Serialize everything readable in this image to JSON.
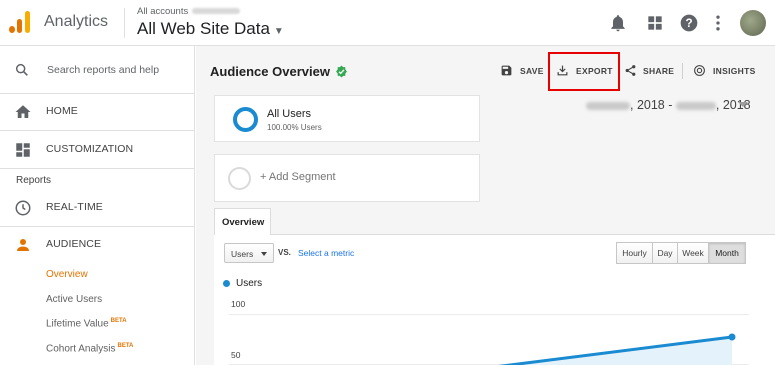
{
  "header": {
    "app_title": "Analytics",
    "account_label": "All accounts",
    "property_name": "All Web Site Data",
    "avatar_label": "user avatar"
  },
  "sidebar": {
    "search_placeholder": "Search reports and help",
    "nav": [
      {
        "label": "HOME",
        "icon": "home-icon"
      },
      {
        "label": "CUSTOMIZATION",
        "icon": "dashboard-icon"
      }
    ],
    "reports_label": "Reports",
    "report_nav": [
      {
        "label": "REAL-TIME",
        "icon": "clock-icon"
      },
      {
        "label": "AUDIENCE",
        "icon": "person-icon"
      }
    ],
    "audience_sub": [
      {
        "label": "Overview",
        "active": true
      },
      {
        "label": "Active Users"
      },
      {
        "label": "Lifetime Value",
        "badge": "BETA"
      },
      {
        "label": "Cohort Analysis",
        "badge": "BETA"
      }
    ]
  },
  "main": {
    "page_title": "Audience Overview",
    "actions": {
      "save": "SAVE",
      "export": "EXPORT",
      "share": "SHARE",
      "insights": "INSIGHTS"
    },
    "segments": {
      "active_name": "All Users",
      "active_sub": "100.00% Users",
      "add_label": "+ Add Segment"
    },
    "date_range": {
      "start_suffix": ", 2018 - ",
      "end_suffix": ", 2018"
    },
    "tab_label": "Overview",
    "metric_select": "Users",
    "vs_label": "VS.",
    "select_metric": "Select a metric",
    "granularity": [
      {
        "label": "Hourly"
      },
      {
        "label": "Day"
      },
      {
        "label": "Week"
      },
      {
        "label": "Month",
        "active": true
      }
    ],
    "legend_label": "Users",
    "y_ticks": [
      "100",
      "50"
    ]
  },
  "colors": {
    "accent_orange": "#e37400",
    "series_blue": "#1a8ad1",
    "export_highlight": "#e60000",
    "verified_green": "#34a853",
    "link_blue": "#1a73e8"
  },
  "chart_data": {
    "type": "line",
    "series": [
      {
        "name": "Users",
        "points": [
          {
            "x": 0.0,
            "y": 0
          },
          {
            "x": 1.0,
            "y": 77
          }
        ]
      }
    ],
    "ylim": [
      0,
      100
    ],
    "yticks": [
      50,
      100
    ]
  }
}
